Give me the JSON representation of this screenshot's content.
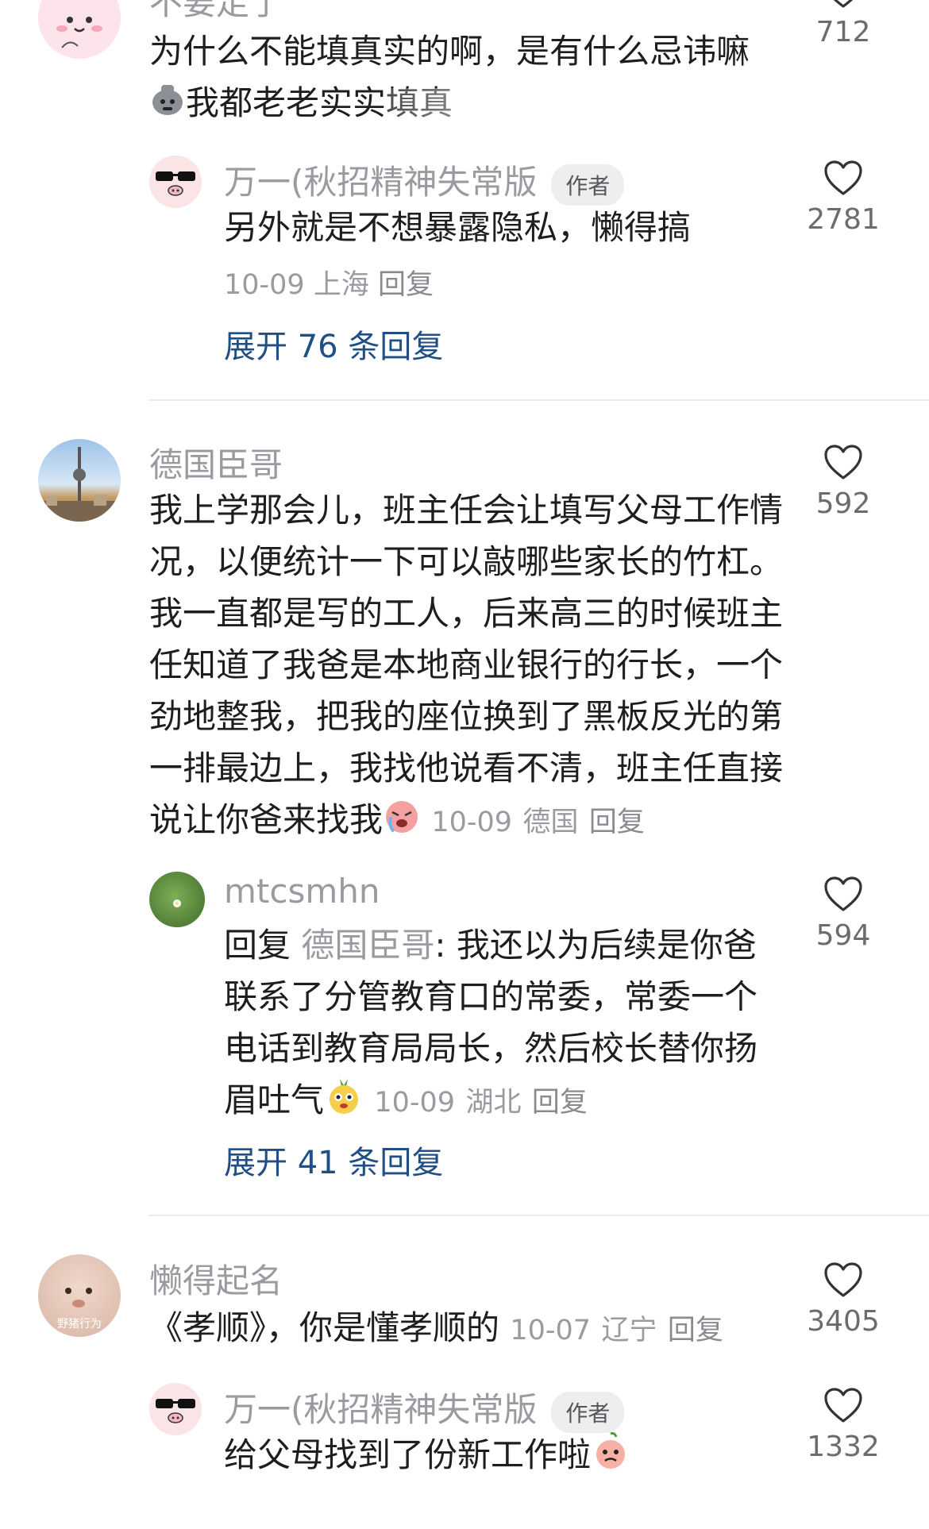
{
  "comments": [
    {
      "user": "不要走了",
      "text_line1": "为什么不能填真实的啊，是有什么忌讳嘛",
      "text_line2": "我都老老实实填真",
      "likes": "712",
      "avatar_icon": "pink-bunny-avatar"
    },
    {
      "user": "万一(秋招精神失常版",
      "badge": "作者",
      "text": "另外就是不想暴露隐私，懒得搞",
      "date": "10-09",
      "location": "上海",
      "reply": "回复",
      "likes": "2781",
      "expand": "展开 76 条回复",
      "avatar_icon": "sunglasses-pig-avatar"
    },
    {
      "user": "德国臣哥",
      "lines": [
        "我上学那会儿，班主任会让填写父母工作情",
        "况，以便统计一下可以敲哪些家长的竹杠。",
        "我一直都是写的工人，后来高三的时候班主",
        "任知道了我爸是本地商业银行的行长，一个",
        "劲地整我，把我的座位换到了黑板反光的第",
        "一排最边上，我找他说看不清，班主任直接",
        "说让你爸来找我"
      ],
      "date": "10-09",
      "location": "德国",
      "reply": "回复",
      "likes": "592",
      "avatar_icon": "tv-tower-city-avatar"
    },
    {
      "user": "mtcsmhn",
      "reply_prefix": "回复",
      "reply_to": "德国臣哥",
      "lines": [
        ": 我还以为后续是你爸",
        "联系了分管教育口的常委，常委一个",
        "电话到教育局局长，然后校长替你扬",
        "眉吐气"
      ],
      "date": "10-09",
      "location": "湖北",
      "reply": "回复",
      "likes": "594",
      "expand": "展开 41 条回复",
      "avatar_icon": "green-grass-avatar"
    },
    {
      "user": "懒得起名",
      "text": "《孝顺》，你是懂孝顺的",
      "date": "10-07",
      "location": "辽宁",
      "reply": "回复",
      "likes": "3405",
      "avatar_caption": "野猪行为",
      "avatar_icon": "baby-face-avatar"
    },
    {
      "user": "万一(秋招精神失常版",
      "badge": "作者",
      "text": "给父母找到了份新工作啦",
      "likes": "1332",
      "avatar_icon": "sunglasses-pig-avatar"
    }
  ]
}
